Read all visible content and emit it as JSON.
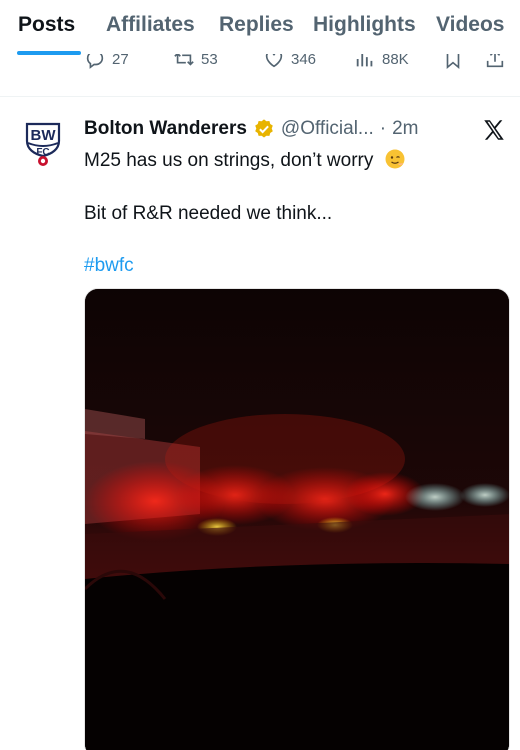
{
  "tabs": [
    {
      "label": "Posts",
      "active": true
    },
    {
      "label": "Affiliates",
      "active": false
    },
    {
      "label": "Replies",
      "active": false
    },
    {
      "label": "Highlights",
      "active": false
    },
    {
      "label": "Videos",
      "active": false
    }
  ],
  "previous_post": {
    "replies": "27",
    "reposts": "53",
    "likes": "346",
    "views": "88K"
  },
  "post": {
    "author": "Bolton Wanderers",
    "handle": "@Official...",
    "separator": "·",
    "time": "2m",
    "verified": "gold-check",
    "line1": "M25 has us on strings, don’t worry",
    "line2": "Bit of R&R needed we think...",
    "hashtag": "#bwfc",
    "media": "photo-traffic-at-night-in-rain"
  },
  "colors": {
    "accent": "#1d9bf0",
    "text": "#0f1419",
    "muted": "#536471",
    "club_red": "#c8102e",
    "club_navy": "#1c2a5a",
    "verified_gold": "#e8b400"
  }
}
